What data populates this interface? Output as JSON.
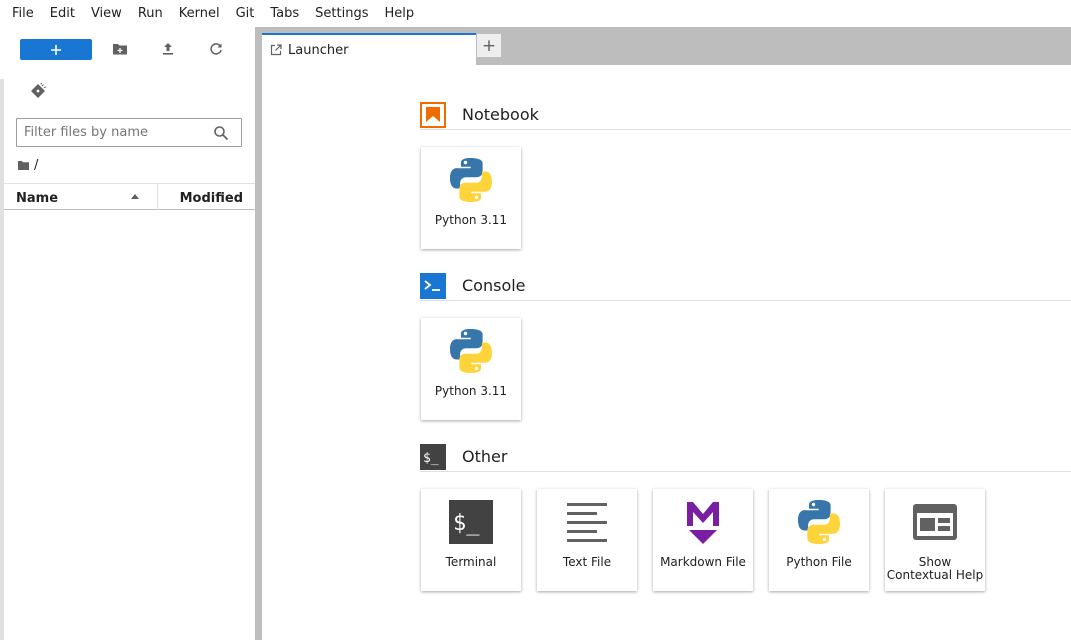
{
  "menu": [
    "File",
    "Edit",
    "View",
    "Run",
    "Kernel",
    "Git",
    "Tabs",
    "Settings",
    "Help"
  ],
  "sidebar": {
    "new_label": "+",
    "filter_placeholder": "Filter files by name",
    "breadcrumb": "/",
    "columns": {
      "name": "Name",
      "modified": "Modified"
    }
  },
  "tabs": [
    {
      "label": "Launcher"
    }
  ],
  "add_tab_label": "+",
  "launcher": {
    "sections": [
      {
        "title": "Notebook",
        "cards": [
          {
            "label": "Python 3.11",
            "icon": "python-icon"
          }
        ]
      },
      {
        "title": "Console",
        "cards": [
          {
            "label": "Python 3.11",
            "icon": "python-icon"
          }
        ]
      },
      {
        "title": "Other",
        "cards": [
          {
            "label": "Terminal",
            "icon": "terminal-icon"
          },
          {
            "label": "Text File",
            "icon": "text-file-icon"
          },
          {
            "label": "Markdown File",
            "icon": "markdown-icon"
          },
          {
            "label": "Python File",
            "icon": "python-icon"
          },
          {
            "label": "Show Contextual Help",
            "icon": "contextual-help-icon"
          }
        ]
      }
    ]
  },
  "colors": {
    "accent": "#1976d2",
    "notebook": "#ef6c00",
    "console": "#1976d2",
    "other": "#424242",
    "markdown": "#7b1fa2"
  }
}
